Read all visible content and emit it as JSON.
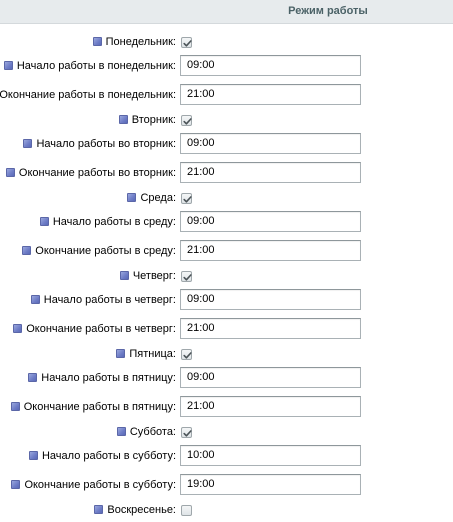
{
  "header": {
    "title": "Режим работы"
  },
  "days": [
    {
      "day_label": "Понедельник:",
      "day_checked": true,
      "start_label": "Начало работы в понедельник:",
      "start_value": "09:00",
      "end_label": "Окончание работы в понедельник:",
      "end_value": "21:00"
    },
    {
      "day_label": "Вторник:",
      "day_checked": true,
      "start_label": "Начало работы во вторник:",
      "start_value": "09:00",
      "end_label": "Окончание работы во вторник:",
      "end_value": "21:00"
    },
    {
      "day_label": "Среда:",
      "day_checked": true,
      "start_label": "Начало работы в среду:",
      "start_value": "09:00",
      "end_label": "Окончание работы в среду:",
      "end_value": "21:00"
    },
    {
      "day_label": "Четверг:",
      "day_checked": true,
      "start_label": "Начало работы в четверг:",
      "start_value": "09:00",
      "end_label": "Окончание работы в четверг:",
      "end_value": "21:00"
    },
    {
      "day_label": "Пятница:",
      "day_checked": true,
      "start_label": "Начало работы в пятницу:",
      "start_value": "09:00",
      "end_label": "Окончание работы в пятницу:",
      "end_value": "21:00"
    },
    {
      "day_label": "Суббота:",
      "day_checked": true,
      "start_label": "Начало работы в субботу:",
      "start_value": "10:00",
      "end_label": "Окончание работы в субботу:",
      "end_value": "19:00"
    },
    {
      "day_label": "Воскресенье:",
      "day_checked": false
    }
  ],
  "icons": {
    "hint": "help-hint-icon",
    "check": "checkmark-icon"
  }
}
